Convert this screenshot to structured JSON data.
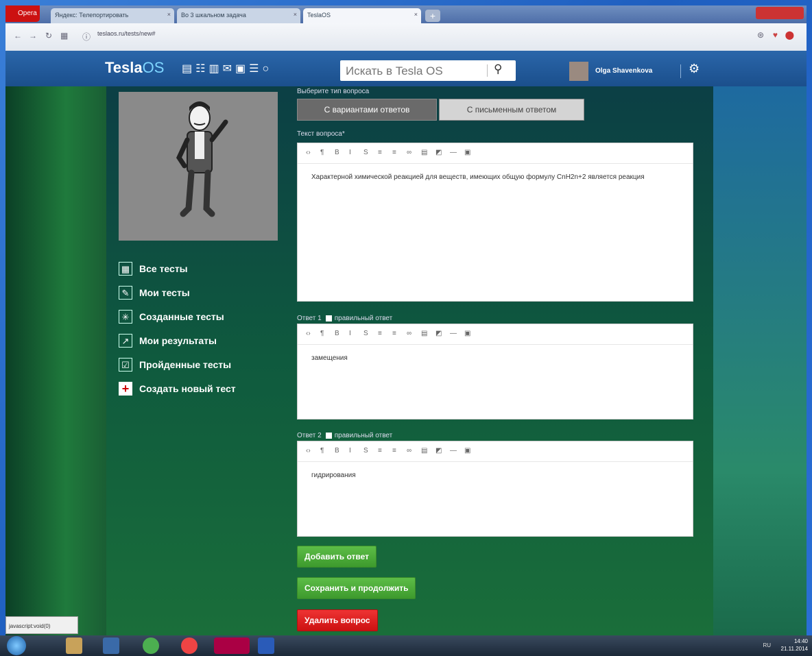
{
  "browser": {
    "menu_label": "Opera",
    "tabs": [
      {
        "label": "Яндекс: Телепортировать"
      },
      {
        "label": "Во 3 шкальном задача"
      },
      {
        "label": "TeslaOS"
      }
    ],
    "url": "teslaos.ru/tests/new#"
  },
  "header": {
    "logo_main": "Tesla",
    "logo_os": "OS",
    "search_placeholder": "Искать в Tesla OS",
    "username": "Olga Shavenkova"
  },
  "sidebar": {
    "items": [
      {
        "label": "Все тесты",
        "icon": "tests-icon"
      },
      {
        "label": "Мои тесты",
        "icon": "my-tests-icon"
      },
      {
        "label": "Созданные тесты",
        "icon": "created-tests-icon"
      },
      {
        "label": "Мои результаты",
        "icon": "results-chart-icon"
      },
      {
        "label": "Пройденные тесты",
        "icon": "checkbox-icon"
      },
      {
        "label": "Создать новый тест",
        "icon": "plus-icon"
      }
    ]
  },
  "form": {
    "type_label": "Выберите тип вопроса",
    "type_options": [
      "С вариантами ответов",
      "С письменным ответом"
    ],
    "question_label": "Текст вопроса*",
    "question_text": "Характерной химической реакцией для веществ, имеющих общую формулу CnH2n+2 является реакция",
    "answers": [
      {
        "label": "Ответ 1",
        "correct_label": "правильный ответ",
        "text": "замещения"
      },
      {
        "label": "Ответ 2",
        "correct_label": "правильный ответ",
        "text": "гидрирования"
      }
    ],
    "toolbar_glyphs": [
      "‹›",
      "¶",
      "B",
      "I",
      "S",
      "≡",
      "≡",
      "∞",
      "▤",
      "◩",
      "—",
      "▣"
    ],
    "add_answer": "Добавить ответ",
    "save_continue": "Сохранить и продолжить",
    "delete_question": "Удалить вопрос"
  },
  "status_text": "javascript:void(0)",
  "taskbar": {
    "tray_lang": "RU",
    "time": "14:40",
    "date": "21.11.2014"
  }
}
